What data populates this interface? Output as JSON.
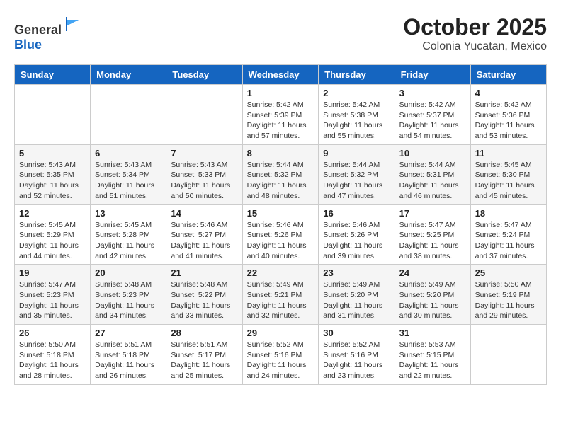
{
  "header": {
    "logo": {
      "text_general": "General",
      "text_blue": "Blue"
    },
    "month": "October 2025",
    "location": "Colonia Yucatan, Mexico"
  },
  "weekdays": [
    "Sunday",
    "Monday",
    "Tuesday",
    "Wednesday",
    "Thursday",
    "Friday",
    "Saturday"
  ],
  "weeks": [
    [
      {
        "day": "",
        "info": ""
      },
      {
        "day": "",
        "info": ""
      },
      {
        "day": "",
        "info": ""
      },
      {
        "day": "1",
        "info": "Sunrise: 5:42 AM\nSunset: 5:39 PM\nDaylight: 11 hours\nand 57 minutes."
      },
      {
        "day": "2",
        "info": "Sunrise: 5:42 AM\nSunset: 5:38 PM\nDaylight: 11 hours\nand 55 minutes."
      },
      {
        "day": "3",
        "info": "Sunrise: 5:42 AM\nSunset: 5:37 PM\nDaylight: 11 hours\nand 54 minutes."
      },
      {
        "day": "4",
        "info": "Sunrise: 5:42 AM\nSunset: 5:36 PM\nDaylight: 11 hours\nand 53 minutes."
      }
    ],
    [
      {
        "day": "5",
        "info": "Sunrise: 5:43 AM\nSunset: 5:35 PM\nDaylight: 11 hours\nand 52 minutes."
      },
      {
        "day": "6",
        "info": "Sunrise: 5:43 AM\nSunset: 5:34 PM\nDaylight: 11 hours\nand 51 minutes."
      },
      {
        "day": "7",
        "info": "Sunrise: 5:43 AM\nSunset: 5:33 PM\nDaylight: 11 hours\nand 50 minutes."
      },
      {
        "day": "8",
        "info": "Sunrise: 5:44 AM\nSunset: 5:32 PM\nDaylight: 11 hours\nand 48 minutes."
      },
      {
        "day": "9",
        "info": "Sunrise: 5:44 AM\nSunset: 5:32 PM\nDaylight: 11 hours\nand 47 minutes."
      },
      {
        "day": "10",
        "info": "Sunrise: 5:44 AM\nSunset: 5:31 PM\nDaylight: 11 hours\nand 46 minutes."
      },
      {
        "day": "11",
        "info": "Sunrise: 5:45 AM\nSunset: 5:30 PM\nDaylight: 11 hours\nand 45 minutes."
      }
    ],
    [
      {
        "day": "12",
        "info": "Sunrise: 5:45 AM\nSunset: 5:29 PM\nDaylight: 11 hours\nand 44 minutes."
      },
      {
        "day": "13",
        "info": "Sunrise: 5:45 AM\nSunset: 5:28 PM\nDaylight: 11 hours\nand 42 minutes."
      },
      {
        "day": "14",
        "info": "Sunrise: 5:46 AM\nSunset: 5:27 PM\nDaylight: 11 hours\nand 41 minutes."
      },
      {
        "day": "15",
        "info": "Sunrise: 5:46 AM\nSunset: 5:26 PM\nDaylight: 11 hours\nand 40 minutes."
      },
      {
        "day": "16",
        "info": "Sunrise: 5:46 AM\nSunset: 5:26 PM\nDaylight: 11 hours\nand 39 minutes."
      },
      {
        "day": "17",
        "info": "Sunrise: 5:47 AM\nSunset: 5:25 PM\nDaylight: 11 hours\nand 38 minutes."
      },
      {
        "day": "18",
        "info": "Sunrise: 5:47 AM\nSunset: 5:24 PM\nDaylight: 11 hours\nand 37 minutes."
      }
    ],
    [
      {
        "day": "19",
        "info": "Sunrise: 5:47 AM\nSunset: 5:23 PM\nDaylight: 11 hours\nand 35 minutes."
      },
      {
        "day": "20",
        "info": "Sunrise: 5:48 AM\nSunset: 5:23 PM\nDaylight: 11 hours\nand 34 minutes."
      },
      {
        "day": "21",
        "info": "Sunrise: 5:48 AM\nSunset: 5:22 PM\nDaylight: 11 hours\nand 33 minutes."
      },
      {
        "day": "22",
        "info": "Sunrise: 5:49 AM\nSunset: 5:21 PM\nDaylight: 11 hours\nand 32 minutes."
      },
      {
        "day": "23",
        "info": "Sunrise: 5:49 AM\nSunset: 5:20 PM\nDaylight: 11 hours\nand 31 minutes."
      },
      {
        "day": "24",
        "info": "Sunrise: 5:49 AM\nSunset: 5:20 PM\nDaylight: 11 hours\nand 30 minutes."
      },
      {
        "day": "25",
        "info": "Sunrise: 5:50 AM\nSunset: 5:19 PM\nDaylight: 11 hours\nand 29 minutes."
      }
    ],
    [
      {
        "day": "26",
        "info": "Sunrise: 5:50 AM\nSunset: 5:18 PM\nDaylight: 11 hours\nand 28 minutes."
      },
      {
        "day": "27",
        "info": "Sunrise: 5:51 AM\nSunset: 5:18 PM\nDaylight: 11 hours\nand 26 minutes."
      },
      {
        "day": "28",
        "info": "Sunrise: 5:51 AM\nSunset: 5:17 PM\nDaylight: 11 hours\nand 25 minutes."
      },
      {
        "day": "29",
        "info": "Sunrise: 5:52 AM\nSunset: 5:16 PM\nDaylight: 11 hours\nand 24 minutes."
      },
      {
        "day": "30",
        "info": "Sunrise: 5:52 AM\nSunset: 5:16 PM\nDaylight: 11 hours\nand 23 minutes."
      },
      {
        "day": "31",
        "info": "Sunrise: 5:53 AM\nSunset: 5:15 PM\nDaylight: 11 hours\nand 22 minutes."
      },
      {
        "day": "",
        "info": ""
      }
    ]
  ]
}
